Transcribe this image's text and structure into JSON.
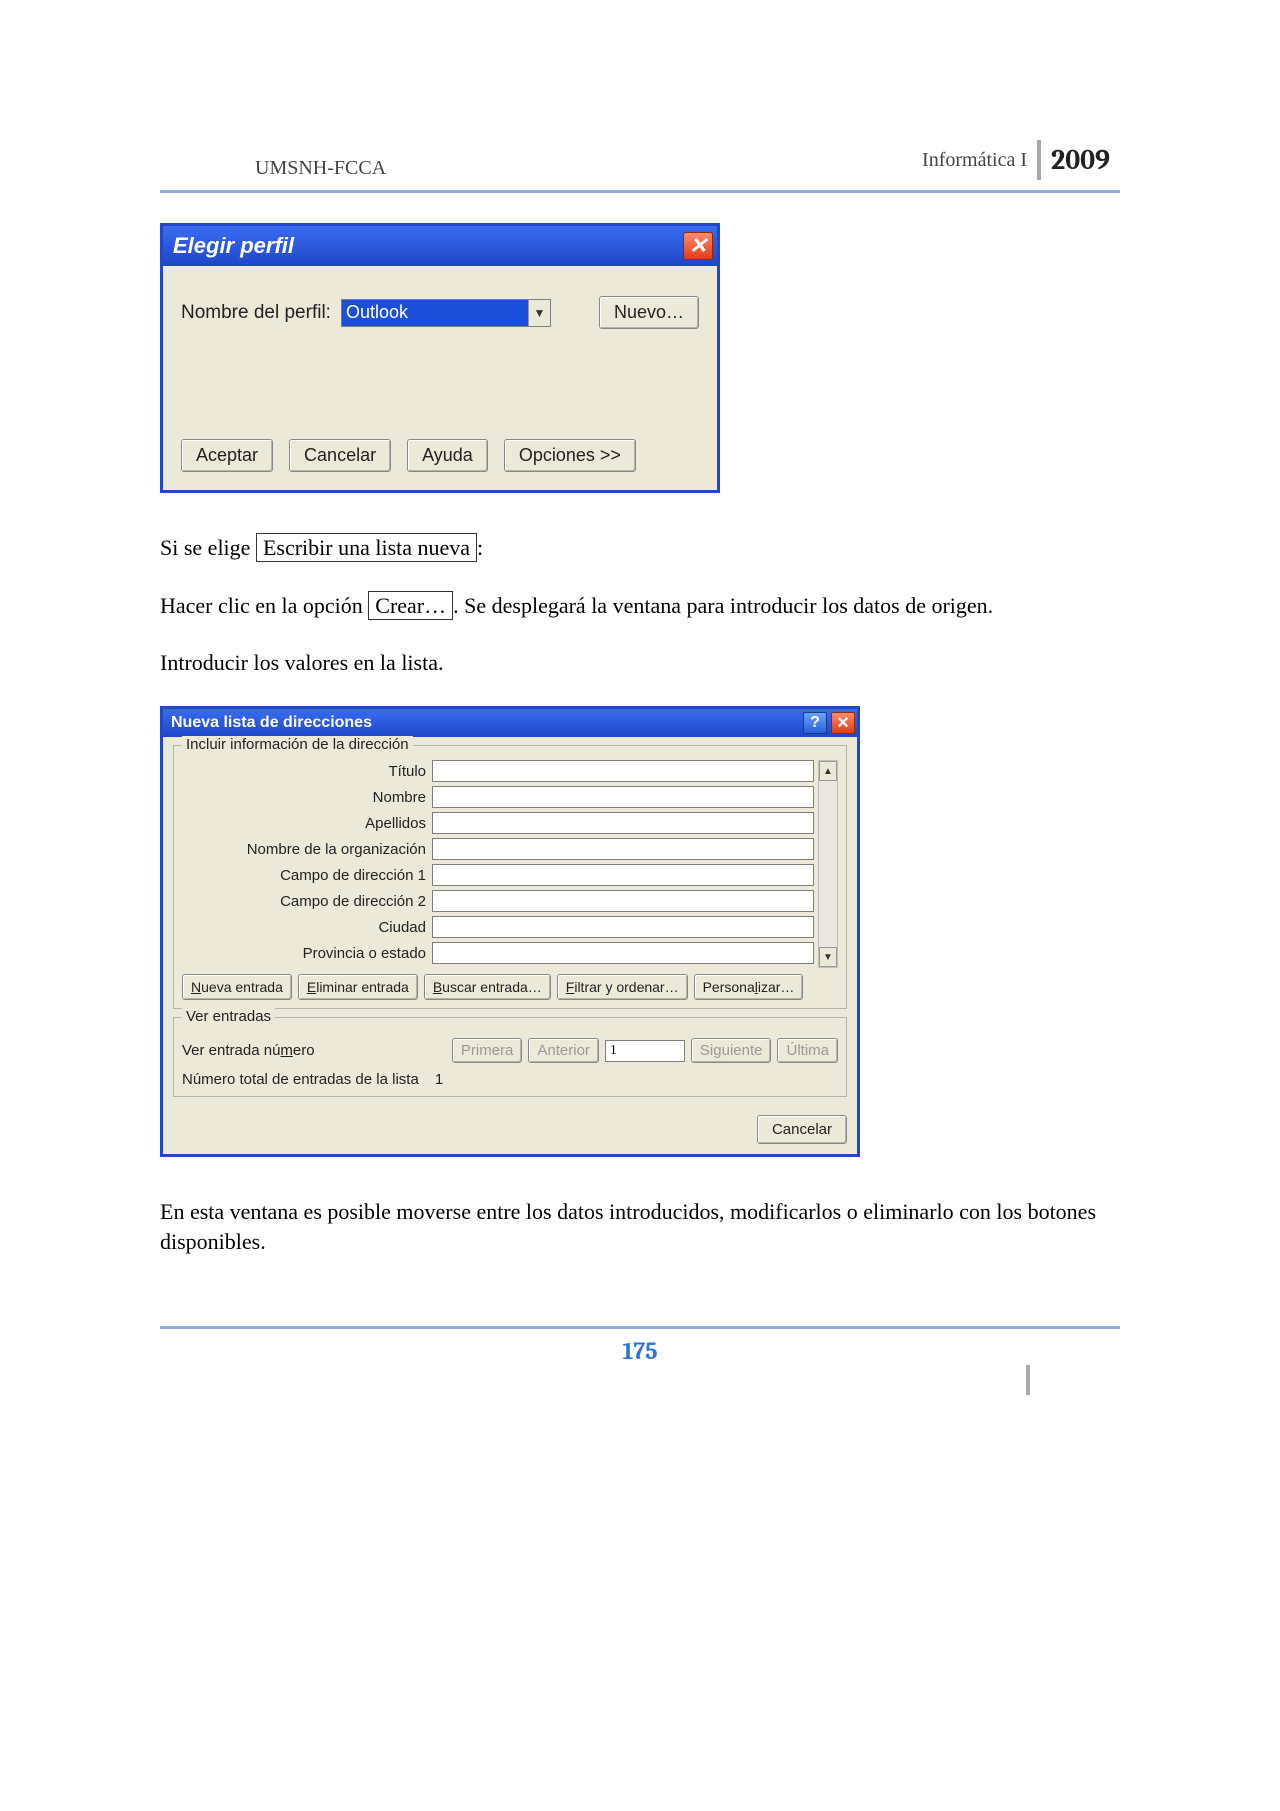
{
  "header": {
    "left": "UMSNH-FCCA",
    "subject": "Informática I",
    "year": "2009"
  },
  "dialog_profile": {
    "title": "Elegir perfil",
    "label_profile_name": "Nombre del perfil:",
    "combo_value": "Outlook",
    "btn_new": "Nuevo…",
    "btn_ok": "Aceptar",
    "btn_cancel": "Cancelar",
    "btn_help": "Ayuda",
    "btn_options": "Opciones >>"
  },
  "body_text": {
    "line1_pre": "Si se elige ",
    "line1_boxed": "Escribir una lista nueva",
    "line1_post": ":",
    "line2_pre": "Hacer clic en la opción ",
    "line2_boxed": "Crear…",
    "line2_post": ". Se desplegará la ventana para introducir los datos de origen.",
    "line3": "Introducir los valores en la lista.",
    "line4": "En esta ventana es posible moverse entre los datos introducidos, modificarlos o eliminarlo con los botones disponibles."
  },
  "dialog_addresslist": {
    "title": "Nueva lista de direcciones",
    "group_info": "Incluir información de la dirección",
    "fields": [
      {
        "label": "Título",
        "value": ""
      },
      {
        "label": "Nombre",
        "value": ""
      },
      {
        "label": "Apellidos",
        "value": ""
      },
      {
        "label": "Nombre de la organización",
        "value": ""
      },
      {
        "label": "Campo de dirección 1",
        "value": ""
      },
      {
        "label": "Campo de dirección 2",
        "value": ""
      },
      {
        "label": "Ciudad",
        "value": ""
      },
      {
        "label": "Provincia o estado",
        "value": ""
      }
    ],
    "btn_new_entry": "Nueva entrada",
    "btn_delete_entry": "Eliminar entrada",
    "btn_search_entry": "Buscar entrada…",
    "btn_filter_sort": "Filtrar y ordenar…",
    "btn_customize": "Personalizar…",
    "group_view": "Ver entradas",
    "label_view_entry_num_pre": "Ver entrada nú",
    "label_view_entry_num_u": "m",
    "label_view_entry_num_post": "ero",
    "btn_first": "Primera",
    "btn_prev": "Anterior",
    "entry_number": "1",
    "btn_next": "Siguiente",
    "btn_last": "Última",
    "label_total_entries": "Número total de entradas de la lista",
    "total_entries_value": "1",
    "btn_cancel": "Cancelar"
  },
  "page_number": "175"
}
